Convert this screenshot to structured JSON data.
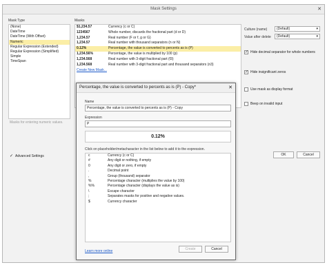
{
  "window": {
    "title": "Mask Settings",
    "close_glyph": "✕"
  },
  "mask_type": {
    "label": "Mask Type",
    "items": [
      {
        "label": "(None)",
        "selected": false
      },
      {
        "label": "DateTime",
        "selected": false
      },
      {
        "label": "DateTime (With Offset)",
        "selected": false
      },
      {
        "label": "Numeric",
        "selected": true
      },
      {
        "label": "Regular Expression (Extended)",
        "selected": false
      },
      {
        "label": "Regular Expression (Simplified)",
        "selected": false
      },
      {
        "label": "Simple",
        "selected": false
      },
      {
        "label": "TimeSpan",
        "selected": false
      }
    ],
    "hint": "Masks for entering numeric values."
  },
  "masks": {
    "label": "Masks",
    "rows": [
      {
        "value": "$1,234.57",
        "desc": "Currency (c or C)",
        "selected": false
      },
      {
        "value": "1234567",
        "desc": "Whole number, discards the fractional part (d or D)",
        "selected": false
      },
      {
        "value": "1,234.57",
        "desc": "Real number (F or f, g or G)",
        "selected": false
      },
      {
        "value": "1,234.57",
        "desc": "Real number with thousand separators (n or N)",
        "selected": false
      },
      {
        "value": "0.12%",
        "desc": "Percentage, the value is converted to percents as is (P)",
        "selected": true
      },
      {
        "value": "1,234.56%",
        "desc": "Percentage, the value is multiplied by 100 (p)",
        "selected": false
      },
      {
        "value": "1,234.568",
        "desc": "Real number with 3-digit fractional part (f3)",
        "selected": false
      },
      {
        "value": "1,234.568",
        "desc": "Real number with 3-digit fractional part and thousand separators (n3)",
        "selected": false
      }
    ],
    "create_link": "Create New Mask..."
  },
  "options": {
    "culture_label": "Culture (name)",
    "culture_value": "(Default)",
    "value_after_delete_label": "Value after delete",
    "value_after_delete_value": "(Default)",
    "hide_decimal_label": "Hide decimal separator for whole numbers",
    "hide_decimal_checked": true,
    "hide_zeros_label": "Hide insignificant zeros",
    "hide_zeros_checked": true,
    "display_format_label": "Use mask as display format",
    "display_format_checked": false,
    "beep_label": "Beep on invalid input",
    "beep_checked": false,
    "dropdown_glyph": "▾",
    "check_glyph": "✓"
  },
  "footer": {
    "advanced_label": "Advanced Settings",
    "advanced_checked": true,
    "ok": "OK",
    "cancel": "Cancel"
  },
  "dialog": {
    "title": "Percentage, the value is converted to percents as is (P) - Copy*",
    "close_glyph": "✕",
    "name_label": "Name",
    "name_value": "Percentage, the value is converted to percents as is (P) - Copy",
    "expression_label": "Expression",
    "expression_value": "P",
    "preview_value": "0.12%",
    "placeholder_hint": "Click on placeholder/metacharacter in the list below to add it to the expression.",
    "placeholders": [
      {
        "symbol": "c",
        "desc": "Currency (c or C)"
      },
      {
        "symbol": "#",
        "desc": "Any digit or nothing, if empty"
      },
      {
        "symbol": "0",
        "desc": "Any digit or zero, if empty"
      },
      {
        "symbol": ".",
        "desc": "Decimal point"
      },
      {
        "symbol": ",",
        "desc": "Group (thousand) separator"
      },
      {
        "symbol": "%",
        "desc": "Percentage character (multiplies the value by 100)"
      },
      {
        "symbol": "%%",
        "desc": "Percentage character (displays the value as is)"
      },
      {
        "symbol": "\\",
        "desc": "Escape character"
      },
      {
        "symbol": ";",
        "desc": "Separates masks for positive and negative values."
      },
      {
        "symbol": "$",
        "desc": "Currency character"
      }
    ],
    "learn_more": "Learn more online",
    "create": "Create",
    "cancel": "Cancel"
  },
  "main_learn_more": "Learn more online"
}
